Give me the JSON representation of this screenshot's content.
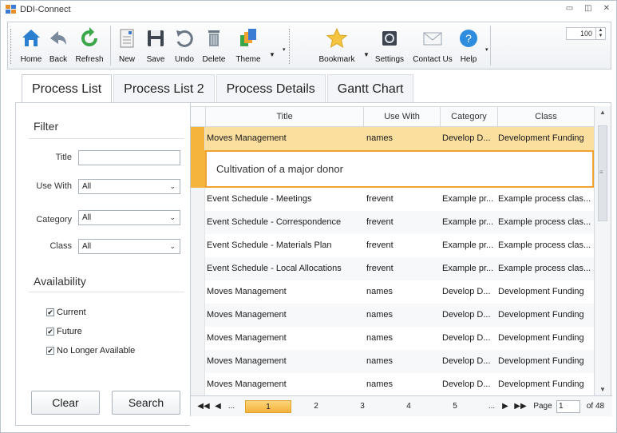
{
  "window": {
    "title": "DDI-Connect"
  },
  "toolbar": {
    "home": "Home",
    "back": "Back",
    "refresh": "Refresh",
    "new": "New",
    "save": "Save",
    "undo": "Undo",
    "delete": "Delete",
    "theme": "Theme",
    "bookmark": "Bookmark",
    "settings": "Settings",
    "contact_us": "Contact Us",
    "help": "Help",
    "zoom_value": "100"
  },
  "tabs": [
    "Process List",
    "Process List 2",
    "Process Details",
    "Gantt Chart"
  ],
  "filter": {
    "heading": "Filter",
    "title_label": "Title",
    "title_value": "",
    "use_with_label": "Use With",
    "use_with_value": "All",
    "category_label": "Category",
    "category_value": "All",
    "class_label": "Class",
    "class_value": "All",
    "availability_heading": "Availability",
    "current_label": "Current",
    "future_label": "Future",
    "no_longer_label": "No Longer Available",
    "current_checked": true,
    "future_checked": true,
    "no_longer_checked": true,
    "clear_label": "Clear",
    "search_label": "Search"
  },
  "grid": {
    "columns": [
      "Title",
      "Use With",
      "Category",
      "Class"
    ],
    "selected_row": {
      "title": "Moves Management",
      "use_with": "names",
      "category": "Develop D...",
      "class": "Development Funding"
    },
    "detail_text": "Cultivation of a major donor",
    "rows": [
      {
        "title": "Event Schedule - Meetings",
        "use_with": "frevent",
        "category": "Example pr...",
        "class": "Example process clas..."
      },
      {
        "title": "Event Schedule - Correspondence",
        "use_with": "frevent",
        "category": "Example pr...",
        "class": "Example process clas..."
      },
      {
        "title": "Event Schedule - Materials Plan",
        "use_with": "frevent",
        "category": "Example pr...",
        "class": "Example process clas..."
      },
      {
        "title": "Event Schedule - Local Allocations",
        "use_with": "frevent",
        "category": "Example pr...",
        "class": "Example process clas..."
      },
      {
        "title": "Moves Management",
        "use_with": "names",
        "category": "Develop D...",
        "class": "Development Funding"
      },
      {
        "title": "Moves Management",
        "use_with": "names",
        "category": "Develop D...",
        "class": "Development Funding"
      },
      {
        "title": "Moves Management",
        "use_with": "names",
        "category": "Develop D...",
        "class": "Development Funding"
      },
      {
        "title": "Moves Management",
        "use_with": "names",
        "category": "Develop D...",
        "class": "Development Funding"
      },
      {
        "title": "Moves Management",
        "use_with": "names",
        "category": "Develop D...",
        "class": "Development Funding"
      }
    ]
  },
  "pager": {
    "first": "◀◀",
    "prev": "◀",
    "ellipsis_left": "...",
    "pages": [
      "1",
      "2",
      "3",
      "4",
      "5"
    ],
    "ellipsis_right": "...",
    "next": "▶",
    "last": "▶▶",
    "page_label": "Page",
    "page_value": "1",
    "of_label": "of 48"
  },
  "colors": {
    "selected_row": "#fbdf9f",
    "accent_orange": "#f0a330",
    "border": "#c6ccd4"
  }
}
